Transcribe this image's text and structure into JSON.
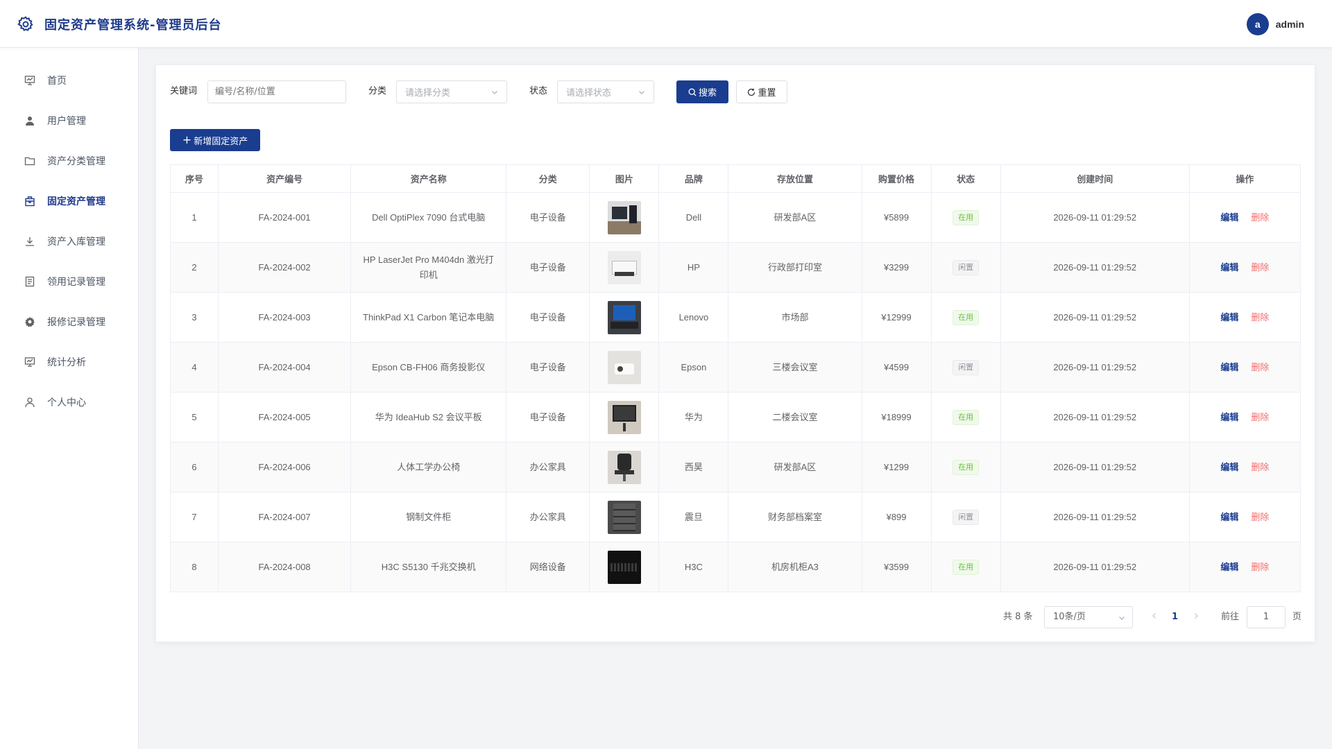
{
  "app": {
    "title": "固定资产管理系统-管理员后台"
  },
  "user": {
    "avatar_letter": "a",
    "name": "admin"
  },
  "sidebar": {
    "items": [
      {
        "label": "首页",
        "icon": "dashboard-icon"
      },
      {
        "label": "用户管理",
        "icon": "user-icon"
      },
      {
        "label": "资产分类管理",
        "icon": "folder-icon"
      },
      {
        "label": "固定资产管理",
        "icon": "package-icon",
        "active": true
      },
      {
        "label": "资产入库管理",
        "icon": "download-icon"
      },
      {
        "label": "领用记录管理",
        "icon": "document-icon"
      },
      {
        "label": "报修记录管理",
        "icon": "gear-icon"
      },
      {
        "label": "统计分析",
        "icon": "chart-icon"
      },
      {
        "label": "个人中心",
        "icon": "person-icon"
      }
    ]
  },
  "filters": {
    "keyword_label": "关键词",
    "keyword_placeholder": "编号/名称/位置",
    "category_label": "分类",
    "category_placeholder": "请选择分类",
    "status_label": "状态",
    "status_placeholder": "请选择状态",
    "search_label": "搜索",
    "reset_label": "重置"
  },
  "toolbar": {
    "add_label": "新增固定资产"
  },
  "table": {
    "columns": [
      "序号",
      "资产编号",
      "资产名称",
      "分类",
      "图片",
      "品牌",
      "存放位置",
      "购置价格",
      "状态",
      "创建时间",
      "操作"
    ],
    "edit_label": "编辑",
    "delete_label": "删除",
    "rows": [
      {
        "no": "1",
        "code": "FA-2024-001",
        "name": "Dell OptiPlex 7090 台式电脑",
        "category": "电子设备",
        "brand": "Dell",
        "location": "研发部A区",
        "price": "¥5899",
        "status": "在用",
        "created": "2026-09-11 01:29:52"
      },
      {
        "no": "2",
        "code": "FA-2024-002",
        "name": "HP LaserJet Pro M404dn 激光打印机",
        "category": "电子设备",
        "brand": "HP",
        "location": "行政部打印室",
        "price": "¥3299",
        "status": "闲置",
        "created": "2026-09-11 01:29:52"
      },
      {
        "no": "3",
        "code": "FA-2024-003",
        "name": "ThinkPad X1 Carbon 笔记本电脑",
        "category": "电子设备",
        "brand": "Lenovo",
        "location": "市场部",
        "price": "¥12999",
        "status": "在用",
        "created": "2026-09-11 01:29:52"
      },
      {
        "no": "4",
        "code": "FA-2024-004",
        "name": "Epson CB-FH06 商务投影仪",
        "category": "电子设备",
        "brand": "Epson",
        "location": "三楼会议室",
        "price": "¥4599",
        "status": "闲置",
        "created": "2026-09-11 01:29:52"
      },
      {
        "no": "5",
        "code": "FA-2024-005",
        "name": "华为 IdeaHub S2 会议平板",
        "category": "电子设备",
        "brand": "华为",
        "location": "二楼会议室",
        "price": "¥18999",
        "status": "在用",
        "created": "2026-09-11 01:29:52"
      },
      {
        "no": "6",
        "code": "FA-2024-006",
        "name": "人体工学办公椅",
        "category": "办公家具",
        "brand": "西昊",
        "location": "研发部A区",
        "price": "¥1299",
        "status": "在用",
        "created": "2026-09-11 01:29:52"
      },
      {
        "no": "7",
        "code": "FA-2024-007",
        "name": "钢制文件柜",
        "category": "办公家具",
        "brand": "震旦",
        "location": "财务部档案室",
        "price": "¥899",
        "status": "闲置",
        "created": "2026-09-11 01:29:52"
      },
      {
        "no": "8",
        "code": "FA-2024-008",
        "name": "H3C S5130 千兆交换机",
        "category": "网络设备",
        "brand": "H3C",
        "location": "机房机柜A3",
        "price": "¥3599",
        "status": "在用",
        "created": "2026-09-11 01:29:52"
      }
    ]
  },
  "pagination": {
    "total_text": "共 8 条",
    "page_size": "10条/页",
    "current_page": "1",
    "goto_label": "前往",
    "goto_value": "1",
    "page_suffix": "页"
  },
  "colors": {
    "primary": "#1a3d8f",
    "title": "#1e3a8a",
    "success": "#67c23a",
    "danger": "#f56c6c"
  }
}
